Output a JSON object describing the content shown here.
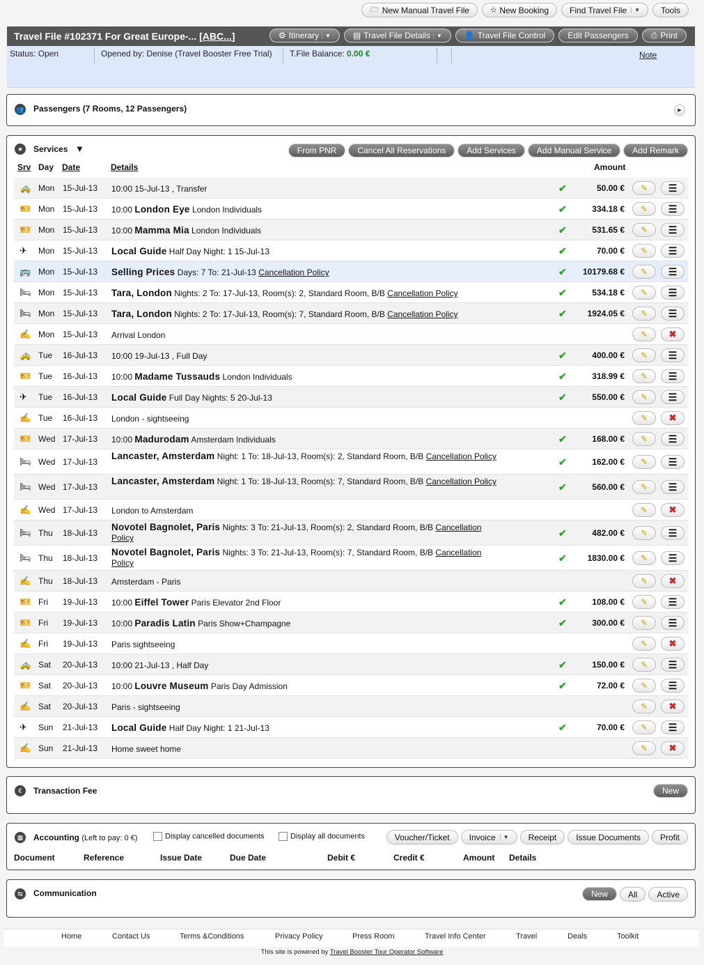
{
  "top_buttons": [
    {
      "label": "New Manual Travel File",
      "icon": "folder-icon"
    },
    {
      "label": "New Booking",
      "icon": "star-icon"
    },
    {
      "label": "Find Travel File",
      "dropdown": true
    },
    {
      "label": "Tools"
    }
  ],
  "travel_file": {
    "title": "Travel File #102371  For Great Europe-... [",
    "abc_link": "ABC...",
    "title_end": "]",
    "buttons": [
      "Itinerary",
      "Travel File Details",
      "Travel File Control",
      "Edit Passengers",
      "Print"
    ],
    "status": "Status: Open",
    "opened_by": "Opened by: Denise (Travel Booster Free Trial)",
    "balance_label": "T.File Balance:",
    "balance_value": "0.00 €",
    "note_link": "Note"
  },
  "passengers": {
    "title": "Passengers (7 Rooms, 12 Passengers)"
  },
  "services": {
    "title": "Services",
    "actions": [
      "From PNR",
      "Cancel All Reservations",
      "Add Services",
      "Add Manual Service",
      "Add Remark"
    ],
    "columns": {
      "srv": "Srv",
      "day": "Day",
      "date": "Date",
      "details": "Details",
      "amount": "Amount"
    },
    "rows": [
      {
        "icon": "car-icon",
        "day": "Mon",
        "date": "15-Jul-13",
        "pre": "10:00 15-Jul-13 , Transfer",
        "bold": "",
        "post": "",
        "status": "confirmed",
        "amount": "50.00 €"
      },
      {
        "icon": "ticket-icon",
        "day": "Mon",
        "date": "15-Jul-13",
        "pre": "10:00 ",
        "bold": "London Eye",
        "post": " London Individuals",
        "status": "confirmed",
        "amount": "334.18 €"
      },
      {
        "icon": "ticket-icon",
        "day": "Mon",
        "date": "15-Jul-13",
        "pre": "10:00 ",
        "bold": "Mamma Mia",
        "post": " London Individuals",
        "status": "confirmed",
        "amount": "531.65 €"
      },
      {
        "icon": "guide-icon",
        "day": "Mon",
        "date": "15-Jul-13",
        "pre": "",
        "bold": "Local Guide",
        "post": " Half Day Night: 1 15-Jul-13",
        "status": "confirmed",
        "amount": "70.00 €"
      },
      {
        "icon": "bus-icon",
        "day": "Mon",
        "date": "15-Jul-13",
        "pre": "",
        "bold": "Selling Prices",
        "post": " Days: 7 To: 21-Jul-13 ",
        "link": "Cancellation Policy",
        "status": "confirmed",
        "amount": "10179.68 €"
      },
      {
        "icon": "bed-icon",
        "day": "Mon",
        "date": "15-Jul-13",
        "pre": "",
        "bold": "Tara, London",
        "post": " Nights: 2 To: 17-Jul-13,  Room(s): 2,  Standard Room, B/B ",
        "link": "Cancellation Policy",
        "status": "confirmed",
        "amount": "534.18 €"
      },
      {
        "icon": "bed-icon",
        "day": "Mon",
        "date": "15-Jul-13",
        "pre": "",
        "bold": "Tara, London",
        "post": " Nights: 2 To: 17-Jul-13,  Room(s): 7,  Standard Room, B/B ",
        "link": "Cancellation Policy",
        "status": "confirmed",
        "amount": "1924.05 €"
      },
      {
        "icon": "remark-icon",
        "day": "Mon",
        "date": "15-Jul-13",
        "pre": "Arrival London",
        "bold": "",
        "post": "",
        "status": "remark",
        "amount": ""
      },
      {
        "icon": "car-icon",
        "day": "Tue",
        "date": "16-Jul-13",
        "pre": "10:00 19-Jul-13 , Full Day",
        "bold": "",
        "post": "",
        "status": "confirmed",
        "amount": "400.00 €"
      },
      {
        "icon": "ticket-icon",
        "day": "Tue",
        "date": "16-Jul-13",
        "pre": "10:00 ",
        "bold": "Madame Tussauds",
        "post": " London Individuals",
        "status": "confirmed",
        "amount": "318.99 €"
      },
      {
        "icon": "guide-icon",
        "day": "Tue",
        "date": "16-Jul-13",
        "pre": "",
        "bold": "Local Guide",
        "post": " Full Day Nights: 5 20-Jul-13",
        "status": "confirmed",
        "amount": "550.00 €"
      },
      {
        "icon": "remark-icon",
        "day": "Tue",
        "date": "16-Jul-13",
        "pre": "London - sightseeing",
        "bold": "",
        "post": "",
        "status": "remark",
        "amount": ""
      },
      {
        "icon": "ticket-icon",
        "day": "Wed",
        "date": "17-Jul-13",
        "pre": "10:00 ",
        "bold": "Madurodam",
        "post": " Amsterdam Individuals",
        "status": "confirmed",
        "amount": "168.00 €"
      },
      {
        "icon": "bed-icon",
        "day": "Wed",
        "date": "17-Jul-13",
        "pre": "",
        "bold": "Lancaster, Amsterdam",
        "post": " Night: 1 To: 18-Jul-13,  Room(s): 2,  Standard Room, B/B ",
        "link": "Cancellation Policy",
        "status": "confirmed",
        "amount": "162.00 €"
      },
      {
        "icon": "bed-icon",
        "day": "Wed",
        "date": "17-Jul-13",
        "pre": "",
        "bold": "Lancaster, Amsterdam",
        "post": " Night: 1 To: 18-Jul-13,  Room(s): 7,  Standard Room, B/B ",
        "link": "Cancellation Policy",
        "status": "confirmed",
        "amount": "560.00 €"
      },
      {
        "icon": "remark-icon",
        "day": "Wed",
        "date": "17-Jul-13",
        "pre": "London to Amsterdam",
        "bold": "",
        "post": "",
        "status": "remark",
        "amount": ""
      },
      {
        "icon": "bed-icon",
        "day": "Thu",
        "date": "18-Jul-13",
        "pre": "",
        "bold": "Novotel Bagnolet, Paris",
        "post": " Nights: 3 To: 21-Jul-13,  Room(s): 2,  Standard Room, B/B ",
        "link": "Cancellation Policy",
        "status": "confirmed",
        "amount": "482.00 €"
      },
      {
        "icon": "bed-icon",
        "day": "Thu",
        "date": "18-Jul-13",
        "pre": "",
        "bold": "Novotel Bagnolet, Paris",
        "post": " Nights: 3 To: 21-Jul-13,  Room(s): 7,  Standard Room, B/B ",
        "link": "Cancellation Policy",
        "status": "confirmed",
        "amount": "1830.00 €"
      },
      {
        "icon": "remark-icon",
        "day": "Thu",
        "date": "18-Jul-13",
        "pre": "Amsterdam - Paris",
        "bold": "",
        "post": "",
        "status": "remark",
        "amount": ""
      },
      {
        "icon": "ticket-icon",
        "day": "Fri",
        "date": "19-Jul-13",
        "pre": "10:00 ",
        "bold": "Eiffel Tower",
        "post": " Paris Elevator 2nd Floor",
        "status": "confirmed",
        "amount": "108.00 €"
      },
      {
        "icon": "ticket-icon",
        "day": "Fri",
        "date": "19-Jul-13",
        "pre": "10:00 ",
        "bold": "Paradis Latin",
        "post": " Paris Show+Champagne",
        "status": "confirmed",
        "amount": "300.00 €"
      },
      {
        "icon": "remark-icon",
        "day": "Fri",
        "date": "19-Jul-13",
        "pre": "Paris sightseeing",
        "bold": "",
        "post": "",
        "status": "remark",
        "amount": ""
      },
      {
        "icon": "car-icon",
        "day": "Sat",
        "date": "20-Jul-13",
        "pre": "10:00 21-Jul-13 , Half Day",
        "bold": "",
        "post": "",
        "status": "confirmed",
        "amount": "150.00 €"
      },
      {
        "icon": "ticket-icon",
        "day": "Sat",
        "date": "20-Jul-13",
        "pre": "10:00 ",
        "bold": "Louvre Museum",
        "post": " Paris Day Admission",
        "status": "confirmed",
        "amount": "72.00 €"
      },
      {
        "icon": "remark-icon",
        "day": "Sat",
        "date": "20-Jul-13",
        "pre": "Paris - sightseeing",
        "bold": "",
        "post": "",
        "status": "remark",
        "amount": ""
      },
      {
        "icon": "guide-icon",
        "day": "Sun",
        "date": "21-Jul-13",
        "pre": "",
        "bold": "Local Guide",
        "post": " Half Day Night: 1 21-Jul-13",
        "status": "confirmed",
        "amount": "70.00 €"
      },
      {
        "icon": "remark-icon",
        "day": "Sun",
        "date": "21-Jul-13",
        "pre": "Home sweet home",
        "bold": "",
        "post": "",
        "status": "remark",
        "amount": ""
      }
    ]
  },
  "transaction_fee": {
    "title": "Transaction Fee",
    "new_button": "New"
  },
  "accounting": {
    "title": "Accounting",
    "left_to_pay": "(Left to pay: 0 €)",
    "cb_cancelled": "Display cancelled documents",
    "cb_all": "Display all documents",
    "buttons": [
      "Voucher/Ticket",
      "Invoice",
      "Receipt",
      "Issue Documents",
      "Profit"
    ],
    "columns": [
      "Document",
      "Reference",
      "Issue Date",
      "Due Date",
      "Debit €",
      "Credit €",
      "Amount",
      "Details"
    ]
  },
  "communication": {
    "title": "Communication",
    "buttons": [
      "New",
      "All",
      "Active"
    ]
  },
  "footer": {
    "links": [
      "Home",
      "Contact Us",
      "Terms &Conditions",
      "Privacy Policy",
      "Press Room",
      "Travel Info Center",
      "Travel",
      "Deals",
      "Toolkit"
    ],
    "powered_text": "This site is powered by ",
    "powered_link": "Travel Booster Tour Operator Software"
  }
}
